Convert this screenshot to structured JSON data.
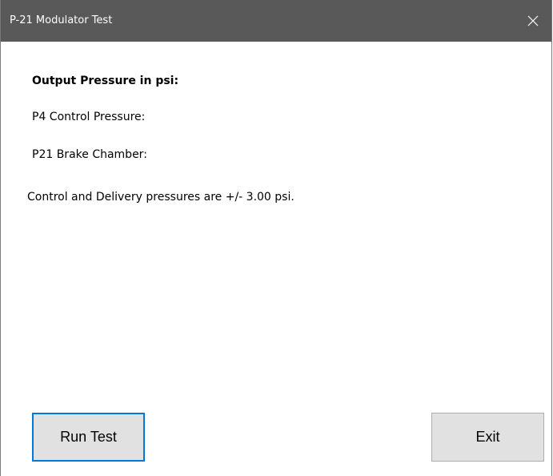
{
  "window": {
    "title": "P-21 Modulator Test"
  },
  "content": {
    "heading": "Output Pressure in psi:",
    "p4_label": "P4 Control Pressure:",
    "p21_label": "P21 Brake Chamber:",
    "tolerance_note": "Control and Delivery pressures are +/- 3.00 psi."
  },
  "buttons": {
    "run_test": "Run Test",
    "exit": "Exit"
  },
  "colors": {
    "titlebar": "#595959",
    "focus_accent": "#0078d7",
    "button_face": "#e1e1e1"
  },
  "icons": {
    "close": "close-icon"
  }
}
